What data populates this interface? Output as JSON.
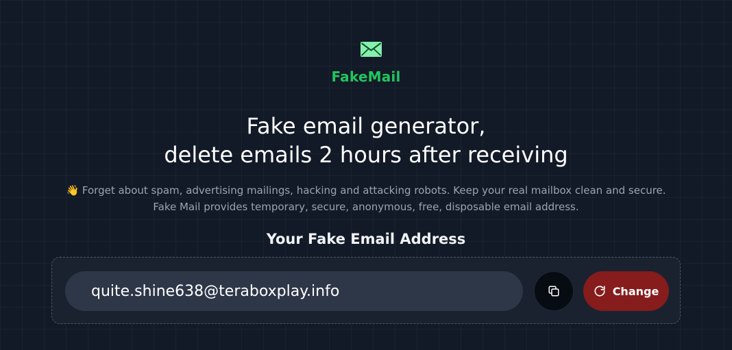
{
  "brand": {
    "name": "FakeMail",
    "icon": "envelope-icon",
    "color": "#22c55e"
  },
  "hero": {
    "title_line1": "Fake email generator,",
    "title_line2": "delete emails 2 hours after receiving",
    "intro_emoji": "👋",
    "intro_text": "Forget about spam, advertising mailings, hacking and attacking robots. Keep your real mailbox clean and secure. Fake Mail provides temporary, secure, anonymous, free, disposable email address."
  },
  "email_section": {
    "title": "Your Fake Email Address",
    "email": "quite.shine638@teraboxplay.info",
    "copy_icon": "copy-icon",
    "change_icon": "refresh-icon",
    "change_label": "Change",
    "change_color": "#861c1c"
  }
}
